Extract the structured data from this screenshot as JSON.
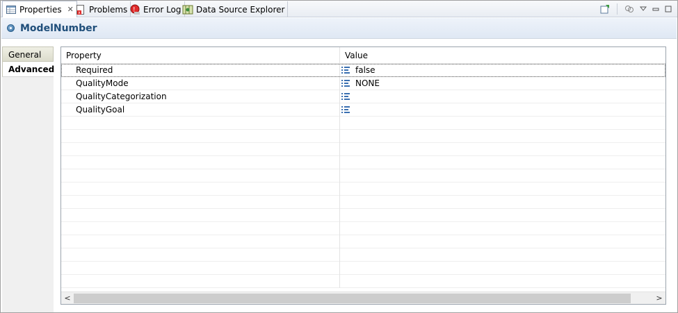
{
  "tabs": [
    {
      "label": "Properties",
      "icon": "properties-icon",
      "active": true
    },
    {
      "label": "Problems",
      "icon": "problems-icon"
    },
    {
      "label": "Error Log",
      "icon": "error-log-icon"
    },
    {
      "label": "Data Source Explorer",
      "icon": "data-source-explorer-icon"
    }
  ],
  "close_glyph": "✕",
  "view_tools": [
    "pin-to-selection-icon",
    "link-with-editor-icon",
    "view-menu-icon",
    "minimize-icon",
    "maximize-icon"
  ],
  "title": {
    "icon": "attribute-icon",
    "text": "ModelNumber"
  },
  "side_tabs": [
    {
      "label": "General"
    },
    {
      "label": "Advanced",
      "selected": true
    }
  ],
  "table": {
    "columns": [
      "Property",
      "Value"
    ],
    "rows": [
      {
        "property": "Required",
        "value": "false"
      },
      {
        "property": "QualityMode",
        "value": "NONE"
      },
      {
        "property": "QualityCategorization",
        "value": ""
      },
      {
        "property": "QualityGoal",
        "value": ""
      }
    ]
  },
  "scrollbar": {
    "left_arrow": "<",
    "right_arrow": ">"
  },
  "colors": {
    "title_text": "#1f4e7a",
    "list_icon": "#3a6fb0"
  }
}
